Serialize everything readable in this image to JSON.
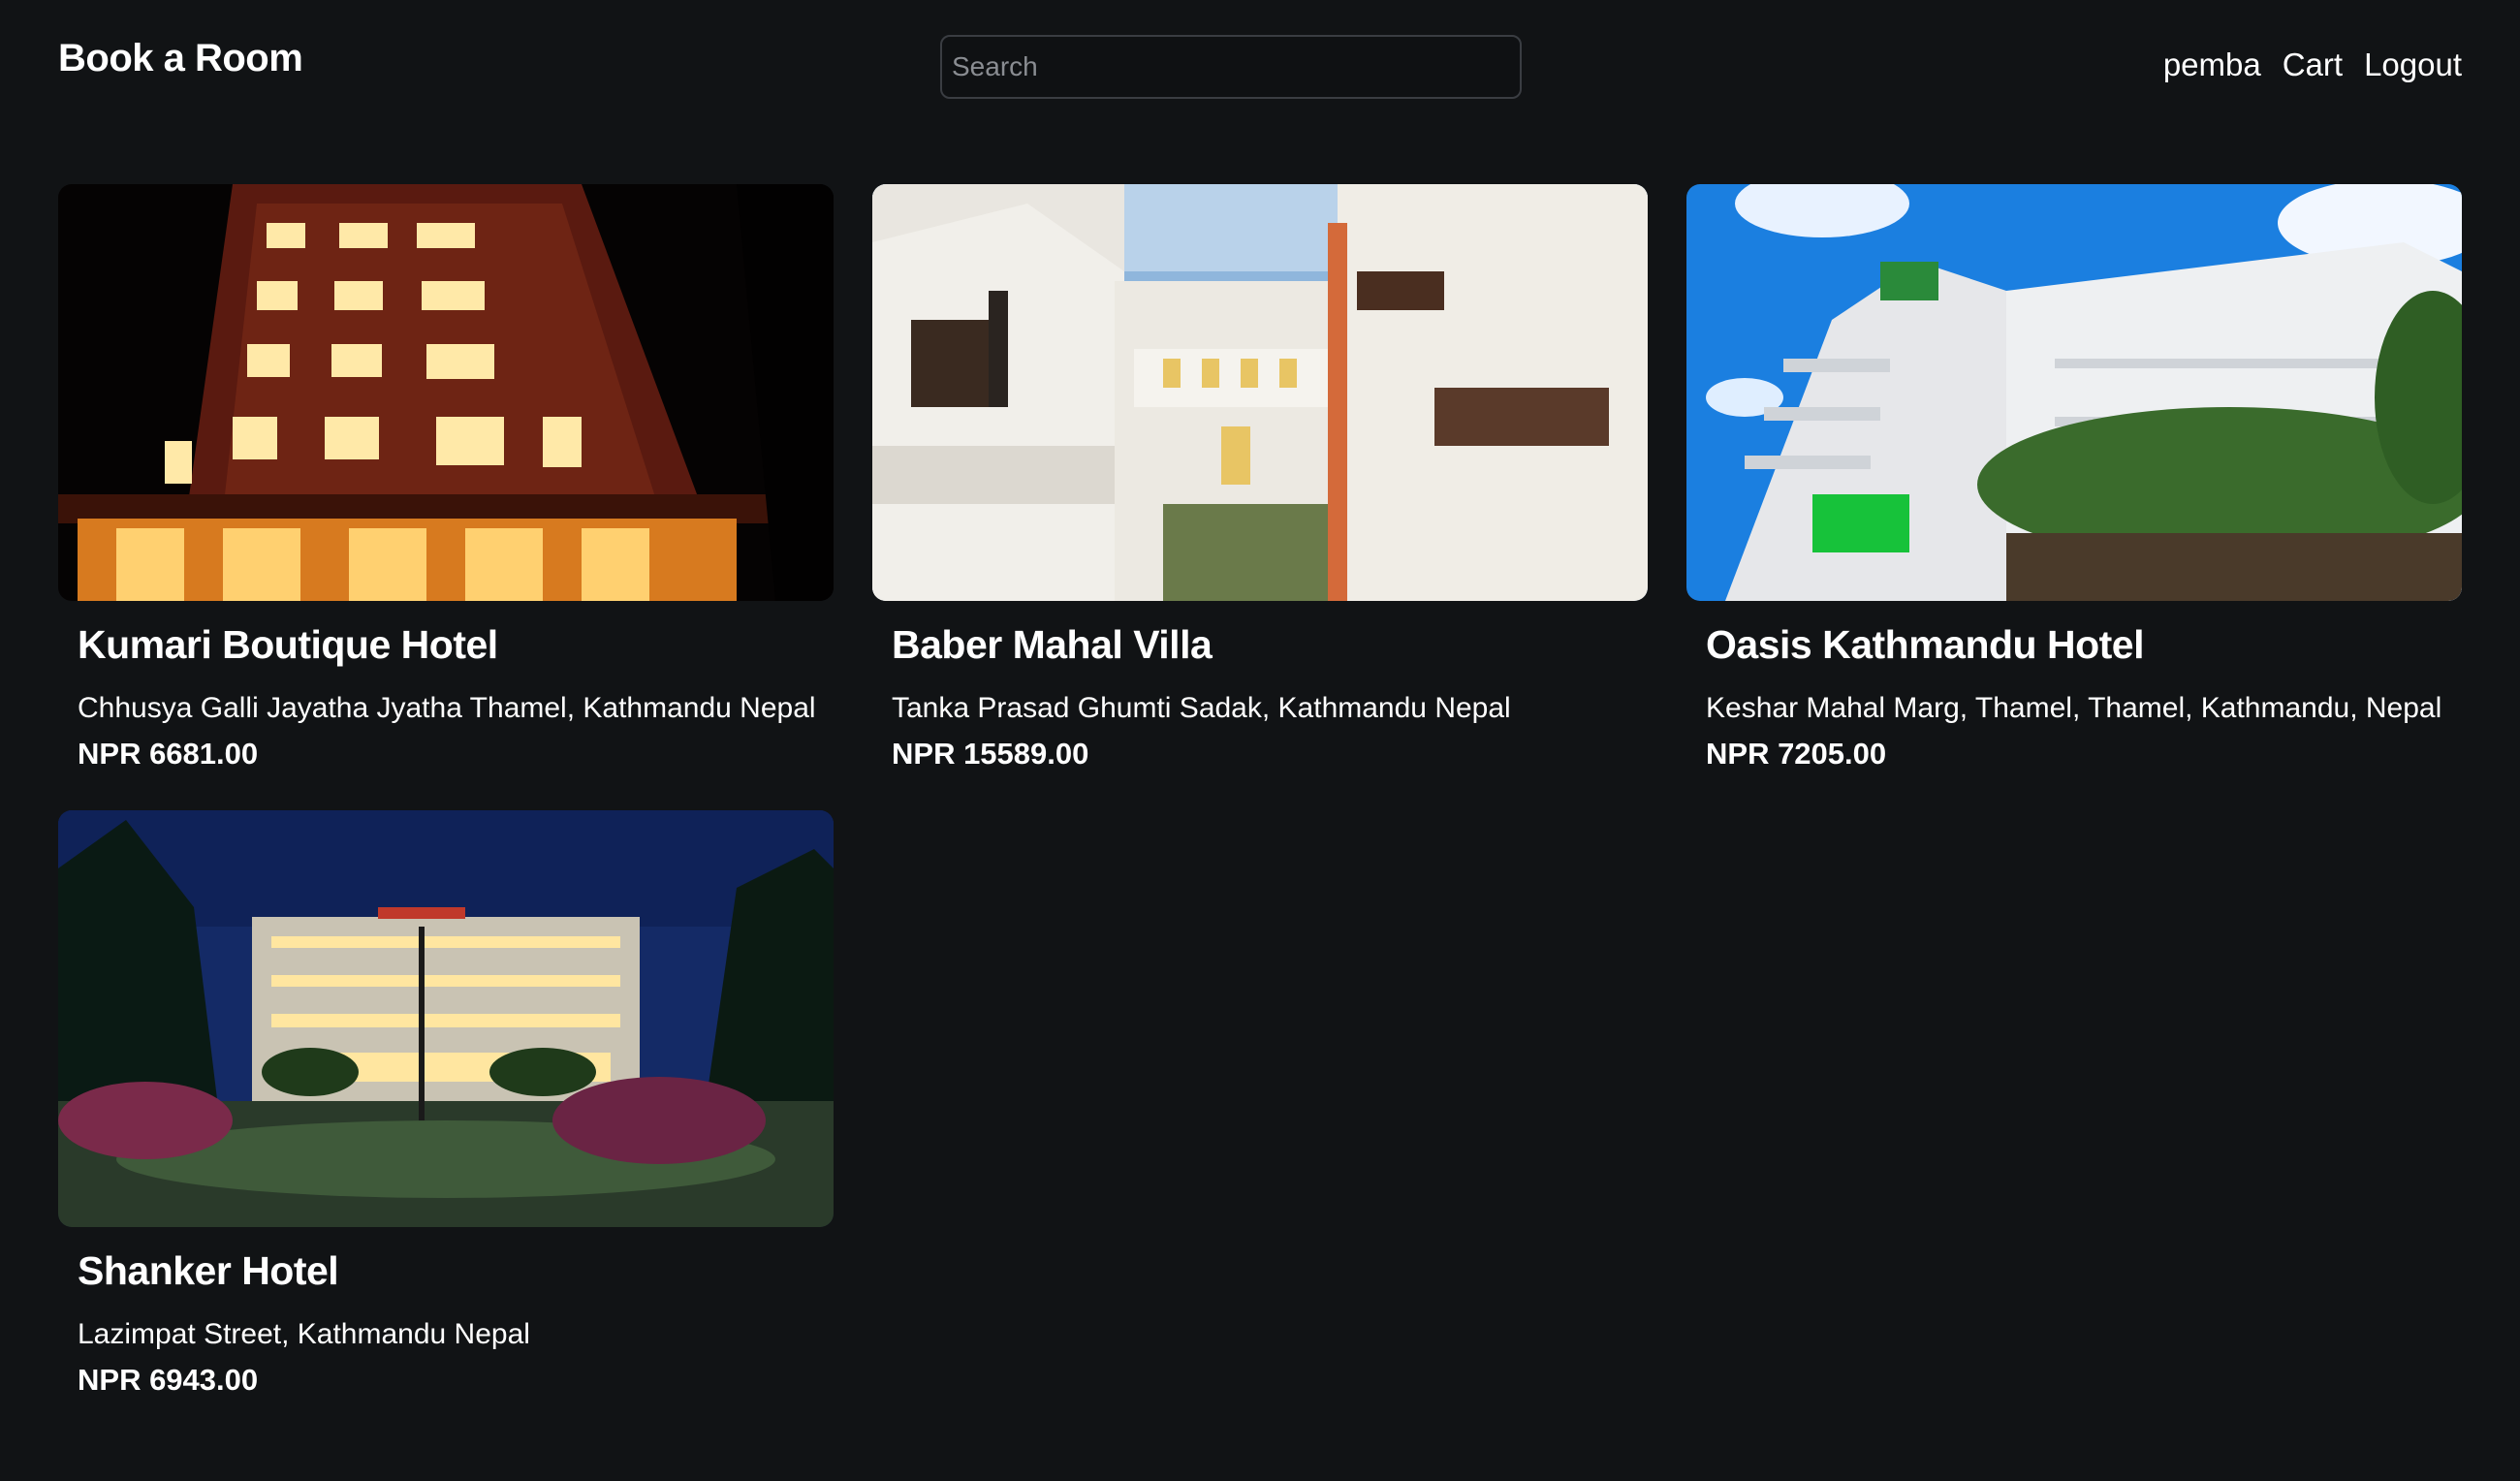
{
  "header": {
    "brand": "Book a Room",
    "search_placeholder": "Search",
    "search_value": "",
    "user": "pemba",
    "cart_label": "Cart",
    "logout_label": "Logout"
  },
  "hotels": [
    {
      "name": "Kumari Boutique Hotel",
      "address": "Chhusya Galli Jayatha Jyatha Thamel, Kathmandu Nepal",
      "price": "NPR 6681.00",
      "image_icon": "hotel-night-facade-photo"
    },
    {
      "name": "Baber Mahal Villa",
      "address": "Tanka Prasad Ghumti Sadak, Kathmandu Nepal",
      "price": "NPR 15589.00",
      "image_icon": "white-palace-courtyard-photo"
    },
    {
      "name": "Oasis Kathmandu Hotel",
      "address": "Keshar Mahal Marg, Thamel, Thamel, Kathmandu, Nepal",
      "price": "NPR 7205.00",
      "image_icon": "white-hotel-blue-sky-photo"
    },
    {
      "name": "Shanker Hotel",
      "address": "Lazimpat Street, Kathmandu Nepal",
      "price": "NPR 6943.00",
      "image_icon": "palace-hotel-dusk-garden-photo"
    }
  ]
}
